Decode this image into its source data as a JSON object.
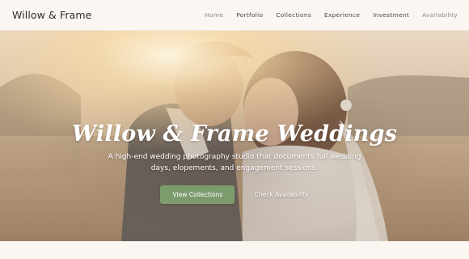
{
  "header": {
    "brand": "Willow & Frame",
    "nav": [
      {
        "label": "Home",
        "muted": true
      },
      {
        "label": "Portfolio",
        "muted": false
      },
      {
        "label": "Collections",
        "muted": false
      },
      {
        "label": "Experience",
        "muted": false
      },
      {
        "label": "Investment",
        "muted": false
      },
      {
        "label": "Availability",
        "muted": true
      }
    ]
  },
  "hero": {
    "title": "Willow & Frame Weddings",
    "subtitle": "A high-end wedding photography studio that documents full wedding days, elopements, and engagement sessions.",
    "primary_cta": "View Collections",
    "secondary_cta": "Check Availability"
  },
  "colors": {
    "background": "#fbf6f1",
    "accent_green": "#7d9c6e",
    "text_dark": "#2f2b28"
  }
}
